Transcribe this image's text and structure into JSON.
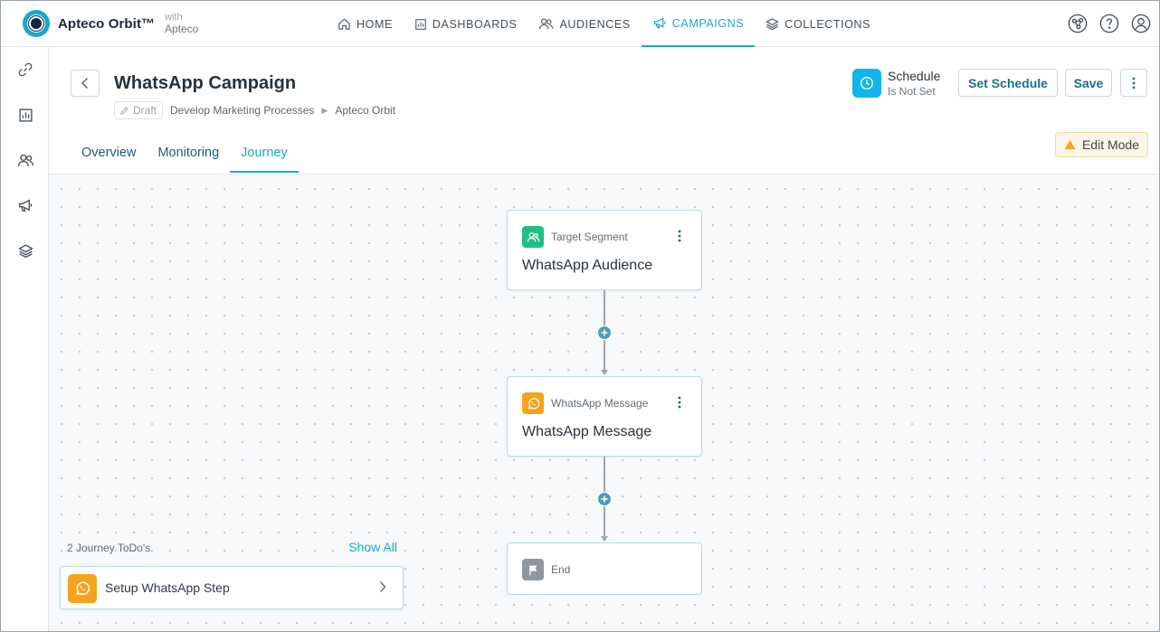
{
  "app": {
    "brand": "Apteco Orbit™",
    "with_label": "with",
    "with_brand": "Apteco"
  },
  "nav": {
    "items": [
      {
        "label": "HOME",
        "icon": "home-icon"
      },
      {
        "label": "DASHBOARDS",
        "icon": "dashboard-icon"
      },
      {
        "label": "AUDIENCES",
        "icon": "audiences-icon"
      },
      {
        "label": "CAMPAIGNS",
        "icon": "megaphone-icon",
        "active": true
      },
      {
        "label": "COLLECTIONS",
        "icon": "layers-icon"
      }
    ]
  },
  "top_icons": [
    "share-network-icon",
    "help-icon",
    "user-account-icon"
  ],
  "rail": [
    "link-icon",
    "dashboard-icon",
    "audiences-icon",
    "megaphone-icon",
    "layers-icon"
  ],
  "header": {
    "title": "WhatsApp Campaign",
    "status_badge": "Draft",
    "breadcrumb": [
      "Develop Marketing Processes",
      "Apteco Orbit"
    ],
    "schedule_title": "Schedule",
    "schedule_status": "Is Not Set",
    "set_schedule_label": "Set Schedule",
    "save_label": "Save"
  },
  "tabs": [
    {
      "label": "Overview"
    },
    {
      "label": "Monitoring"
    },
    {
      "label": "Journey",
      "active": true
    }
  ],
  "edit_mode_label": "Edit Mode",
  "journey": {
    "nodes": [
      {
        "kind": "Target Segment",
        "name": "WhatsApp Audience",
        "icon": "audience-icon",
        "color": "#1fbf84"
      },
      {
        "kind": "WhatsApp Message",
        "name": "WhatsApp Message",
        "icon": "whatsapp-icon",
        "color": "#f7a21b"
      },
      {
        "kind": "End",
        "icon": "flag-icon",
        "color": "#8f979e"
      }
    ]
  },
  "todos": {
    "count_label": "2 Journey ToDo's",
    "show_all_label": "Show All",
    "items": [
      {
        "label": "Setup WhatsApp Step",
        "icon": "whatsapp-icon"
      }
    ]
  },
  "colors": {
    "accent": "#1aa9c9",
    "link": "#1f6e89",
    "schedule": "#12b5ea",
    "warning": "#f5a623"
  }
}
